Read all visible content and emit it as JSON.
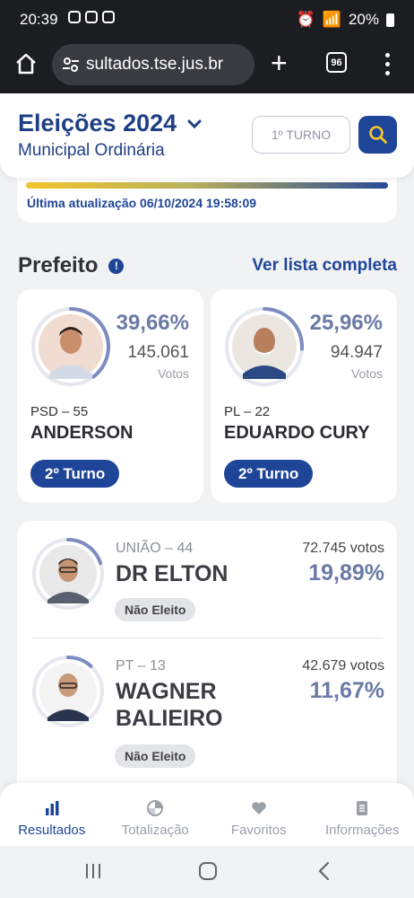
{
  "status_bar": {
    "time": "20:39",
    "battery": "20%"
  },
  "browser": {
    "url": "sultados.tse.jus.br",
    "tab_count": "96"
  },
  "header": {
    "title": "Eleições 2024",
    "subtitle": "Municipal Ordinária",
    "turno_label": "1º TURNO"
  },
  "update": {
    "text": "Última atualização 06/10/2024 19:58:09"
  },
  "section": {
    "title": "Prefeito",
    "see_all": "Ver lista completa"
  },
  "top_candidates": [
    {
      "percent": "39,66%",
      "votes": "145.061",
      "votes_label": "Votos",
      "party": "PSD – 55",
      "name": "ANDERSON",
      "badge": "2º Turno",
      "progress": 0.3966
    },
    {
      "percent": "25,96%",
      "votes": "94.947",
      "votes_label": "Votos",
      "party": "PL – 22",
      "name": "EDUARDO CURY",
      "badge": "2º Turno",
      "progress": 0.2596
    }
  ],
  "other_candidates": [
    {
      "party": "UNIÃO – 44",
      "name": "DR ELTON",
      "votes": "72.745 votos",
      "percent": "19,89%",
      "status": "Não Eleito",
      "progress": 0.1989
    },
    {
      "party": "PT – 13",
      "name": "WAGNER BALIEIRO",
      "votes": "42.679 votos",
      "percent": "11,67%",
      "status": "Não Eleito",
      "progress": 0.1167
    }
  ],
  "bottom_nav": [
    {
      "label": "Resultados",
      "icon": "bar-chart-icon",
      "active": true
    },
    {
      "label": "Totalização",
      "icon": "pie-chart-icon",
      "active": false
    },
    {
      "label": "Favoritos",
      "icon": "heart-icon",
      "active": false
    },
    {
      "label": "Informações",
      "icon": "document-icon",
      "active": false
    }
  ],
  "colors": {
    "primary": "#1f4598",
    "percent": "#6b7aa6",
    "ring": "#7d8cc0"
  }
}
